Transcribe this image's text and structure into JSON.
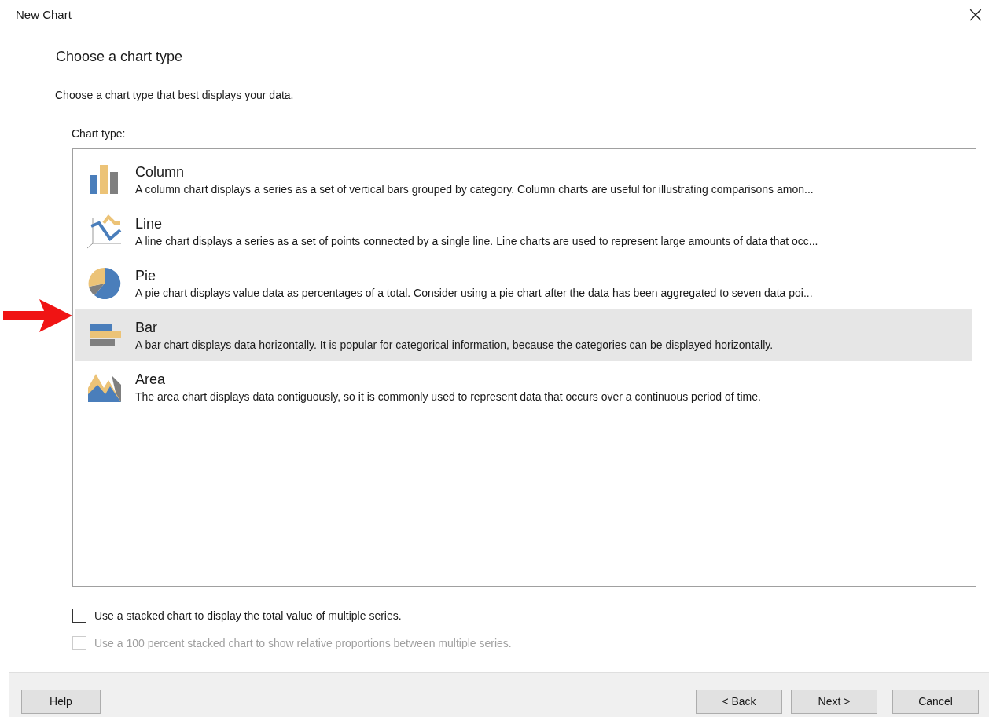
{
  "window": {
    "title": "New Chart",
    "close": "×"
  },
  "heading": "Choose a chart type",
  "instruction": "Choose a chart type that best displays your data.",
  "list_label": "Chart type:",
  "chart_types": [
    {
      "kind": "column",
      "title": "Column",
      "description": "A column chart displays a series as a set of vertical bars grouped by category. Column charts are useful for illustrating comparisons amon...",
      "selected": false
    },
    {
      "kind": "line",
      "title": "Line",
      "description": "A line chart displays a series as a set of points connected by a single line. Line charts are used to represent large amounts of data that occ...",
      "selected": false
    },
    {
      "kind": "pie",
      "title": "Pie",
      "description": "A pie chart displays value data as percentages of a total. Consider using a pie chart after the data has been aggregated to seven data poi...",
      "selected": false
    },
    {
      "kind": "bar",
      "title": "Bar",
      "description": "A bar chart displays data horizontally. It is popular for categorical information, because the categories can be displayed horizontally.",
      "selected": true
    },
    {
      "kind": "area",
      "title": "Area",
      "description": "The area chart displays data contiguously, so it is commonly used to represent data that occurs over a continuous period of time.",
      "selected": false
    }
  ],
  "options": [
    {
      "label": "Use a stacked chart to display the total value of multiple series.",
      "checked": false,
      "disabled": false
    },
    {
      "label": "Use a 100 percent stacked chart to show relative proportions between multiple series.",
      "checked": false,
      "disabled": true
    }
  ],
  "buttons": {
    "help": "Help",
    "back": "< Back",
    "next": "Next >",
    "cancel": "Cancel"
  }
}
